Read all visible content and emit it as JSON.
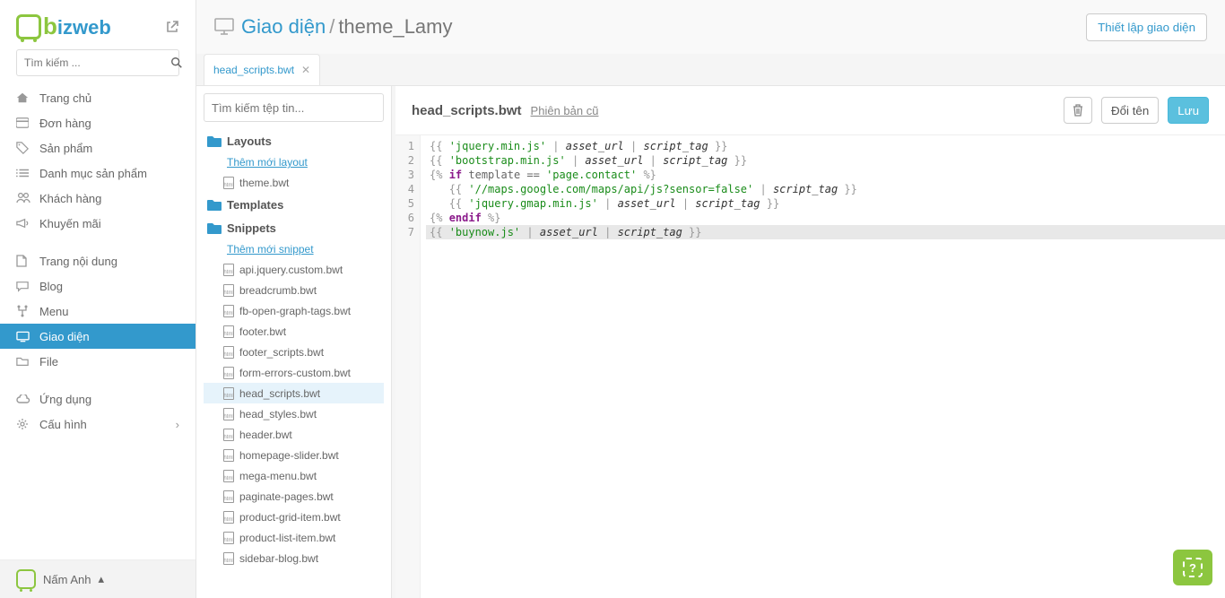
{
  "logo": {
    "text_rest": "izweb"
  },
  "search": {
    "placeholder": "Tìm kiếm ..."
  },
  "nav": [
    {
      "icon": "home",
      "label": "Trang chủ"
    },
    {
      "icon": "card",
      "label": "Đơn hàng"
    },
    {
      "icon": "tag",
      "label": "Sản phẩm"
    },
    {
      "icon": "list",
      "label": "Danh mục sản phẩm"
    },
    {
      "icon": "users",
      "label": "Khách hàng"
    },
    {
      "icon": "horn",
      "label": "Khuyến mãi"
    }
  ],
  "nav2": [
    {
      "icon": "doc",
      "label": "Trang nội dung"
    },
    {
      "icon": "chat",
      "label": "Blog"
    },
    {
      "icon": "tree",
      "label": "Menu"
    },
    {
      "icon": "screen",
      "label": "Giao diện",
      "active": true
    },
    {
      "icon": "folder",
      "label": "File"
    }
  ],
  "nav3": [
    {
      "icon": "cloud",
      "label": "Ứng dụng"
    },
    {
      "icon": "gears",
      "label": "Cấu hình",
      "chev": true
    }
  ],
  "user": {
    "name": "Nấm Anh"
  },
  "header": {
    "crumb_link": "Giao diện",
    "crumb_sep": "/",
    "crumb_cur": "theme_Lamy",
    "config_btn": "Thiết lập giao diện"
  },
  "tab": {
    "label": "head_scripts.bwt"
  },
  "tree": {
    "search_placeholder": "Tìm kiếm tệp tin...",
    "folders": {
      "layouts": {
        "title": "Layouts",
        "add": "Thêm mới layout",
        "files": [
          "theme.bwt"
        ]
      },
      "templates": {
        "title": "Templates"
      },
      "snippets": {
        "title": "Snippets",
        "add": "Thêm mới snippet",
        "files": [
          "api.jquery.custom.bwt",
          "breadcrumb.bwt",
          "fb-open-graph-tags.bwt",
          "footer.bwt",
          "footer_scripts.bwt",
          "form-errors-custom.bwt",
          "head_scripts.bwt",
          "head_styles.bwt",
          "header.bwt",
          "homepage-slider.bwt",
          "mega-menu.bwt",
          "paginate-pages.bwt",
          "product-grid-item.bwt",
          "product-list-item.bwt",
          "sidebar-blog.bwt"
        ],
        "active": "head_scripts.bwt"
      }
    }
  },
  "editor": {
    "title": "head_scripts.bwt",
    "old_version": "Phiên bản cũ",
    "rename": "Đổi tên",
    "save": "Lưu",
    "lines": [
      {
        "segs": [
          [
            "br",
            "{{ "
          ],
          [
            "str",
            "'jquery.min.js'"
          ],
          [
            "br",
            " | "
          ],
          [
            "var",
            "asset_url"
          ],
          [
            "br",
            " | "
          ],
          [
            "var",
            "script_tag"
          ],
          [
            "br",
            " }}"
          ]
        ]
      },
      {
        "segs": [
          [
            "br",
            "{{ "
          ],
          [
            "str",
            "'bootstrap.min.js'"
          ],
          [
            "br",
            " | "
          ],
          [
            "var",
            "asset_url"
          ],
          [
            "br",
            " | "
          ],
          [
            "var",
            "script_tag"
          ],
          [
            "br",
            " }}"
          ]
        ]
      },
      {
        "segs": [
          [
            "br",
            "{% "
          ],
          [
            "kw",
            "if"
          ],
          [
            "t",
            " template == "
          ],
          [
            "str",
            "'page.contact'"
          ],
          [
            "br",
            " %}"
          ]
        ]
      },
      {
        "segs": [
          [
            "t",
            "   "
          ],
          [
            "br",
            "{{ "
          ],
          [
            "str",
            "'//maps.google.com/maps/api/js?sensor=false'"
          ],
          [
            "br",
            " | "
          ],
          [
            "var",
            "script_tag"
          ],
          [
            "br",
            " }}"
          ]
        ]
      },
      {
        "segs": [
          [
            "t",
            "   "
          ],
          [
            "br",
            "{{ "
          ],
          [
            "str",
            "'jquery.gmap.min.js'"
          ],
          [
            "br",
            " | "
          ],
          [
            "var",
            "asset_url"
          ],
          [
            "br",
            " | "
          ],
          [
            "var",
            "script_tag"
          ],
          [
            "br",
            " }}"
          ]
        ]
      },
      {
        "segs": [
          [
            "br",
            "{% "
          ],
          [
            "kw",
            "endif"
          ],
          [
            "br",
            " %}"
          ]
        ]
      },
      {
        "hl": true,
        "segs": [
          [
            "br",
            "{{ "
          ],
          [
            "str",
            "'buynow.js'"
          ],
          [
            "br",
            " | "
          ],
          [
            "var",
            "asset_url"
          ],
          [
            "br",
            " | "
          ],
          [
            "var",
            "script_tag"
          ],
          [
            "br",
            " }}"
          ]
        ]
      }
    ]
  }
}
